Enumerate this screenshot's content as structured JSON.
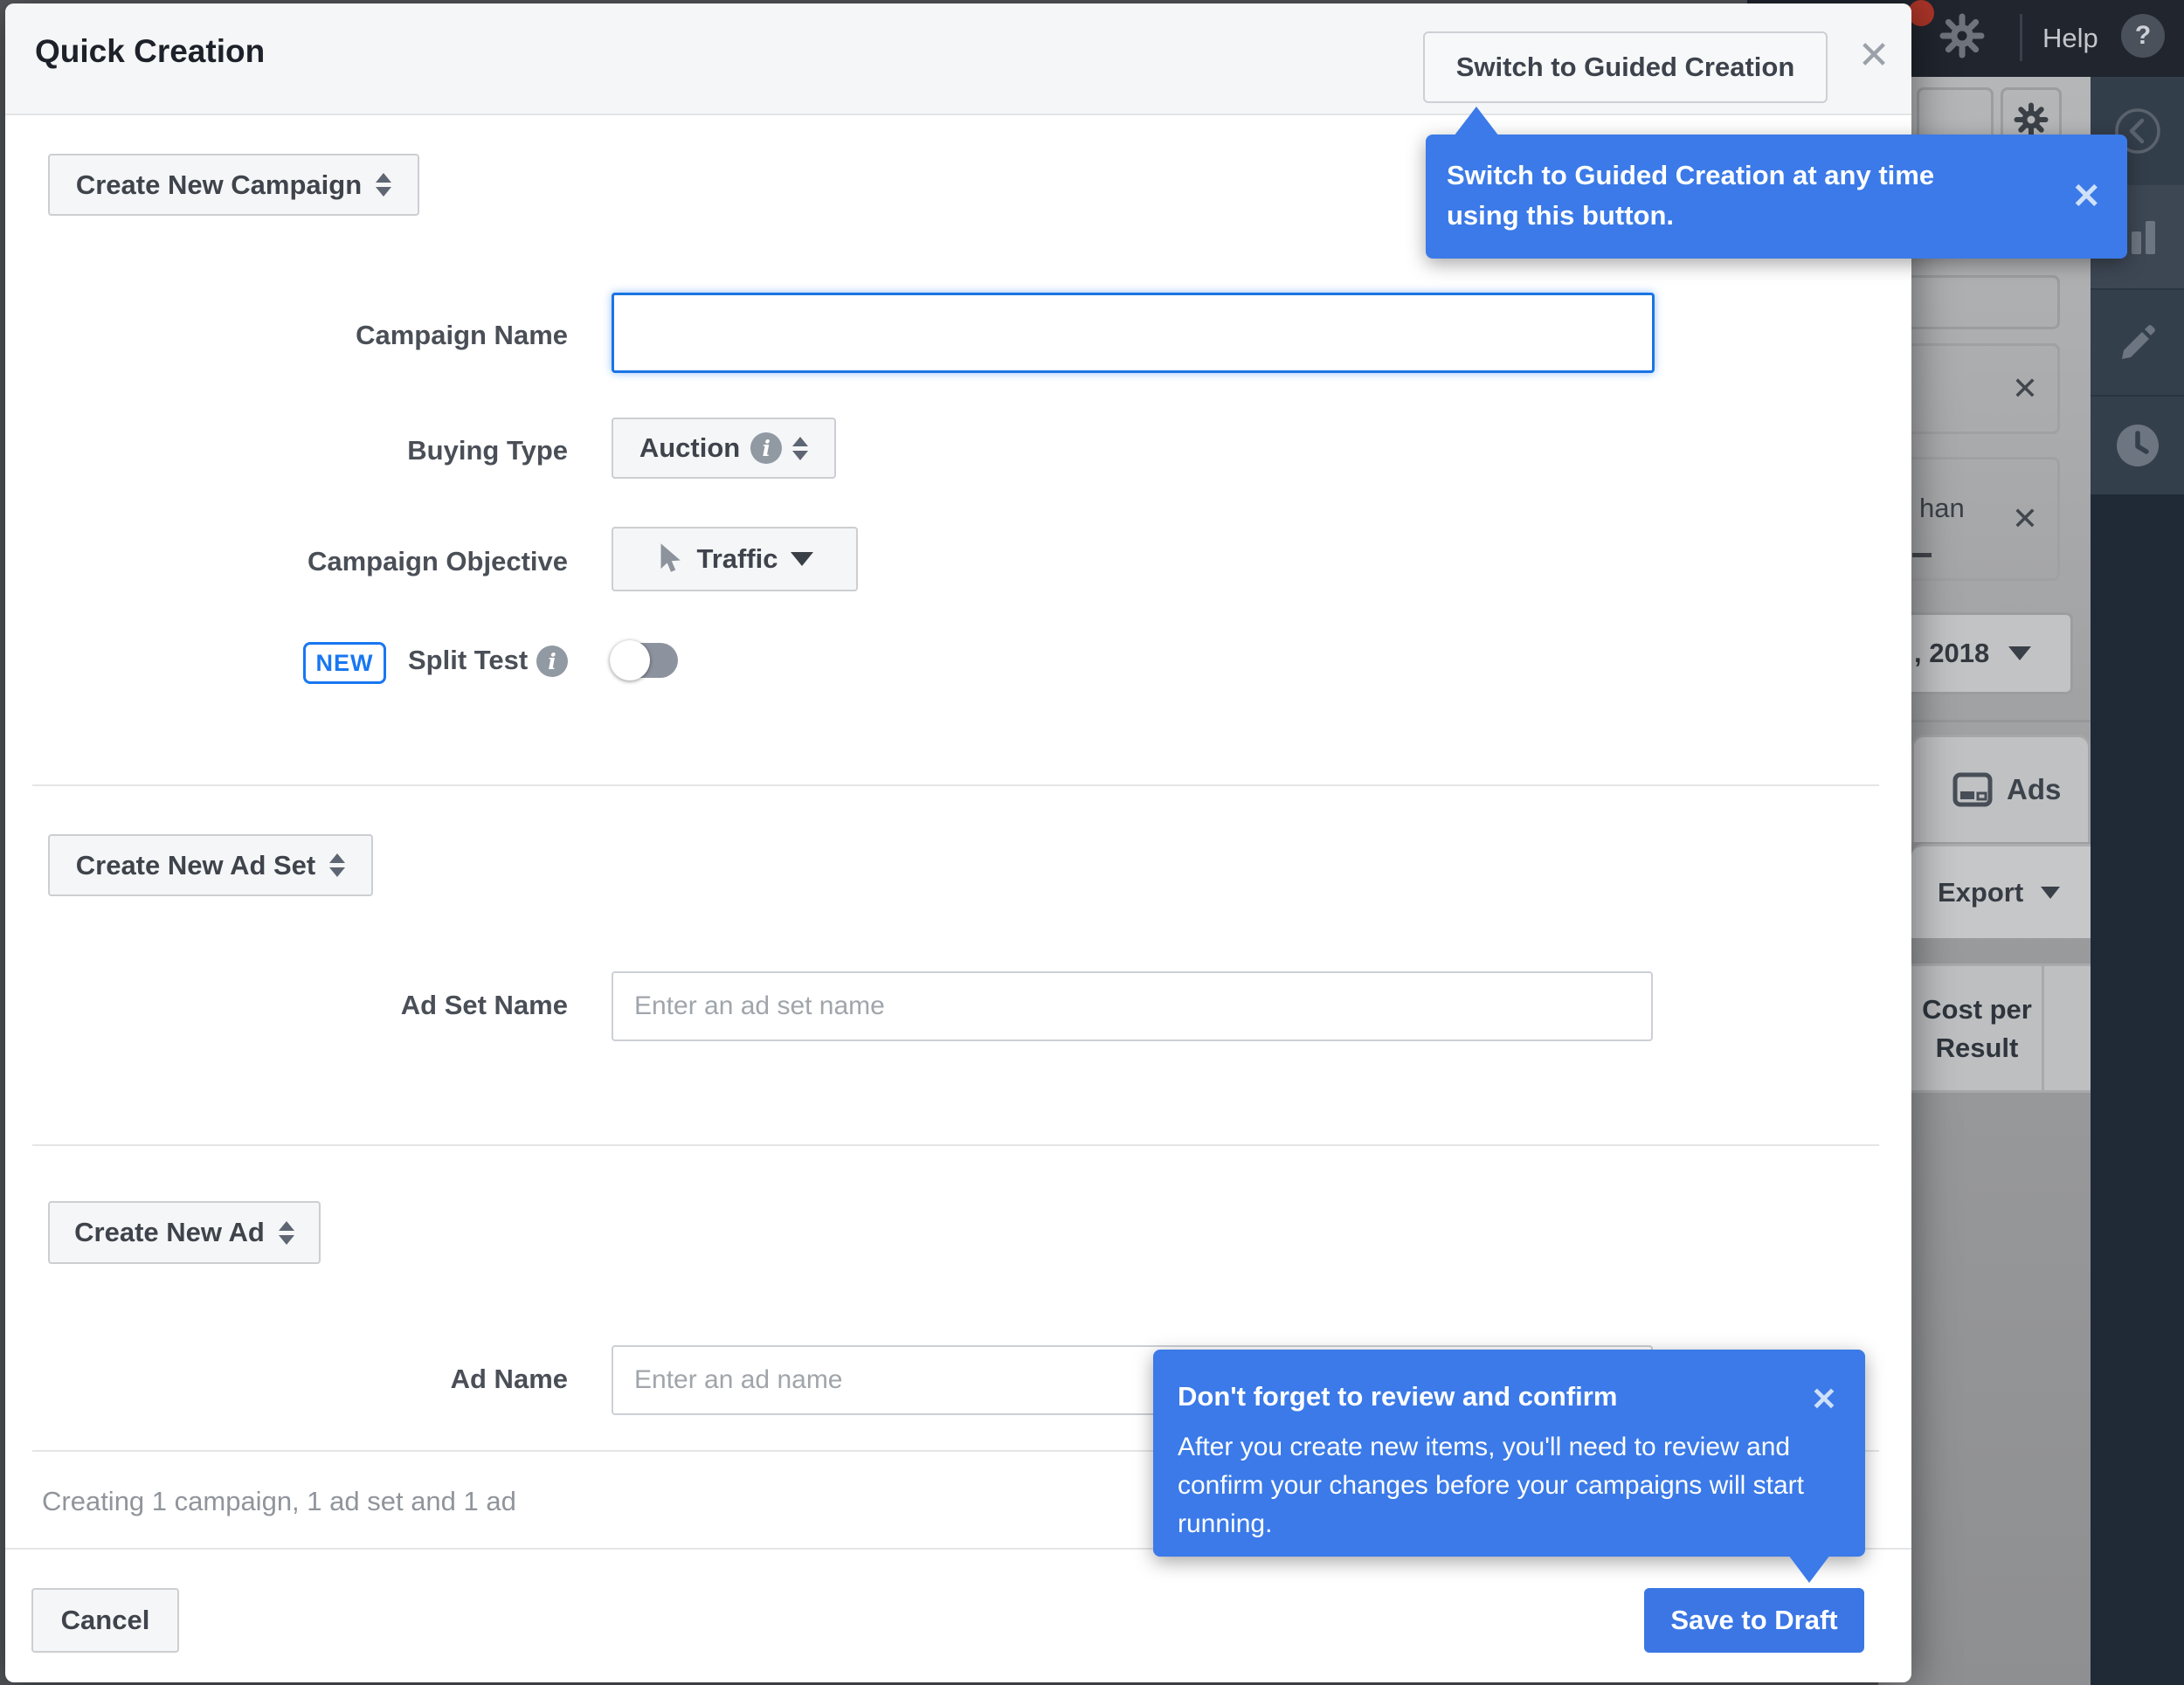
{
  "modal": {
    "title": "Quick Creation",
    "switch_button_label": "Switch to Guided Creation",
    "close_glyph": "✕",
    "campaign": {
      "selector_label": "Create New Campaign",
      "name_label": "Campaign Name",
      "name_value": "",
      "buying_type_label": "Buying Type",
      "buying_type_value": "Auction",
      "objective_label": "Campaign Objective",
      "objective_value": "Traffic",
      "new_badge": "NEW",
      "split_test_label": "Split Test",
      "info_glyph": "i"
    },
    "ad_set": {
      "selector_label": "Create New Ad Set",
      "name_label": "Ad Set Name",
      "name_placeholder": "Enter an ad set name"
    },
    "ad": {
      "selector_label": "Create New Ad",
      "name_label": "Ad Name",
      "name_placeholder": "Enter an ad name"
    },
    "summary_text": "Creating 1 campaign, 1 ad set and 1 ad",
    "cancel_label": "Cancel",
    "save_label": "Save to Draft"
  },
  "tooltips": {
    "switch": {
      "text": "Switch to Guided Creation at any time using this button.",
      "close_glyph": "✕"
    },
    "review": {
      "title": "Don't forget to review and confirm",
      "body": "After you create new items, you'll need to review and confirm your changes before your campaigns will start running.",
      "close_glyph": "✕"
    }
  },
  "background": {
    "navbar": {
      "help_label": "Help",
      "help_glyph": "?"
    },
    "filter_chip_text": "han",
    "filter_close_glyph": "✕",
    "date_range_text": ", 2018",
    "ads_tab_label": "Ads",
    "export_label": "Export",
    "column_header_line1": "Cost per",
    "column_header_line2": "Result"
  },
  "colors": {
    "tooltip_blue": "#3b7ae8",
    "save_button_blue": "#3b76e4",
    "focus_border_blue": "#1b74e4",
    "new_badge_blue": "#1877f2"
  }
}
